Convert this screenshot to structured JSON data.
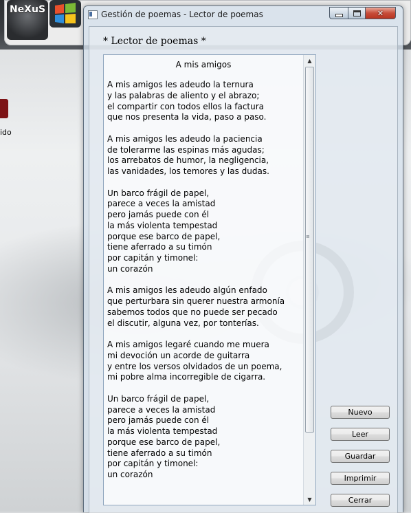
{
  "desktop": {
    "logo_text": "NeXuS",
    "partial_label": "ido"
  },
  "window": {
    "title": "Gestión de poemas - Lector de poemas",
    "controls": [
      "minimize",
      "maximize",
      "close"
    ]
  },
  "group": {
    "label": "* Lector de poemas *"
  },
  "poem": {
    "title": "A mis amigos",
    "stanzas": [
      [
        "A mis amigos les adeudo la ternura",
        "y las palabras de aliento y el abrazo;",
        "el compartir con todos ellos la factura",
        "que nos presenta la vida, paso a paso."
      ],
      [
        "A mis amigos les adeudo la paciencia",
        "de tolerarme las espinas más agudas;",
        "los arrebatos de humor, la negligencia,",
        "las vanidades, los temores y las dudas."
      ],
      [
        "Un barco frágil de papel,",
        "parece a veces la amistad",
        "pero jamás puede con él",
        "la más violenta tempestad",
        "porque ese barco de papel,",
        "tiene aferrado a su timón",
        "por capitán y timonel:",
        "un corazón"
      ],
      [
        "A mis amigos les adeudo algún enfado",
        "que perturbara sin querer nuestra armonía",
        "sabemos todos que no puede ser pecado",
        "el discutir, alguna vez, por tonterías."
      ],
      [
        "A mis amigos legaré cuando me muera",
        "mi devoción un acorde de guitarra",
        "y entre los versos olvidados de un poema,",
        "mi pobre alma incorregible de cigarra."
      ],
      [
        "Un barco frágil de papel,",
        "parece a veces la amistad",
        "pero jamás puede con él",
        "la más violenta tempestad",
        "porque ese barco de papel,",
        "tiene aferrado a su timón",
        "por capitán y timonel:",
        "un corazón"
      ]
    ]
  },
  "buttons": {
    "nuevo": "Nuevo",
    "leer": "Leer",
    "guardar": "Guardar",
    "imprimir": "Imprimir",
    "cerrar": "Cerrar"
  },
  "colors": {
    "window_frame": "#d6e1ec",
    "close_button": "#c74d3a",
    "text": "#000000"
  }
}
